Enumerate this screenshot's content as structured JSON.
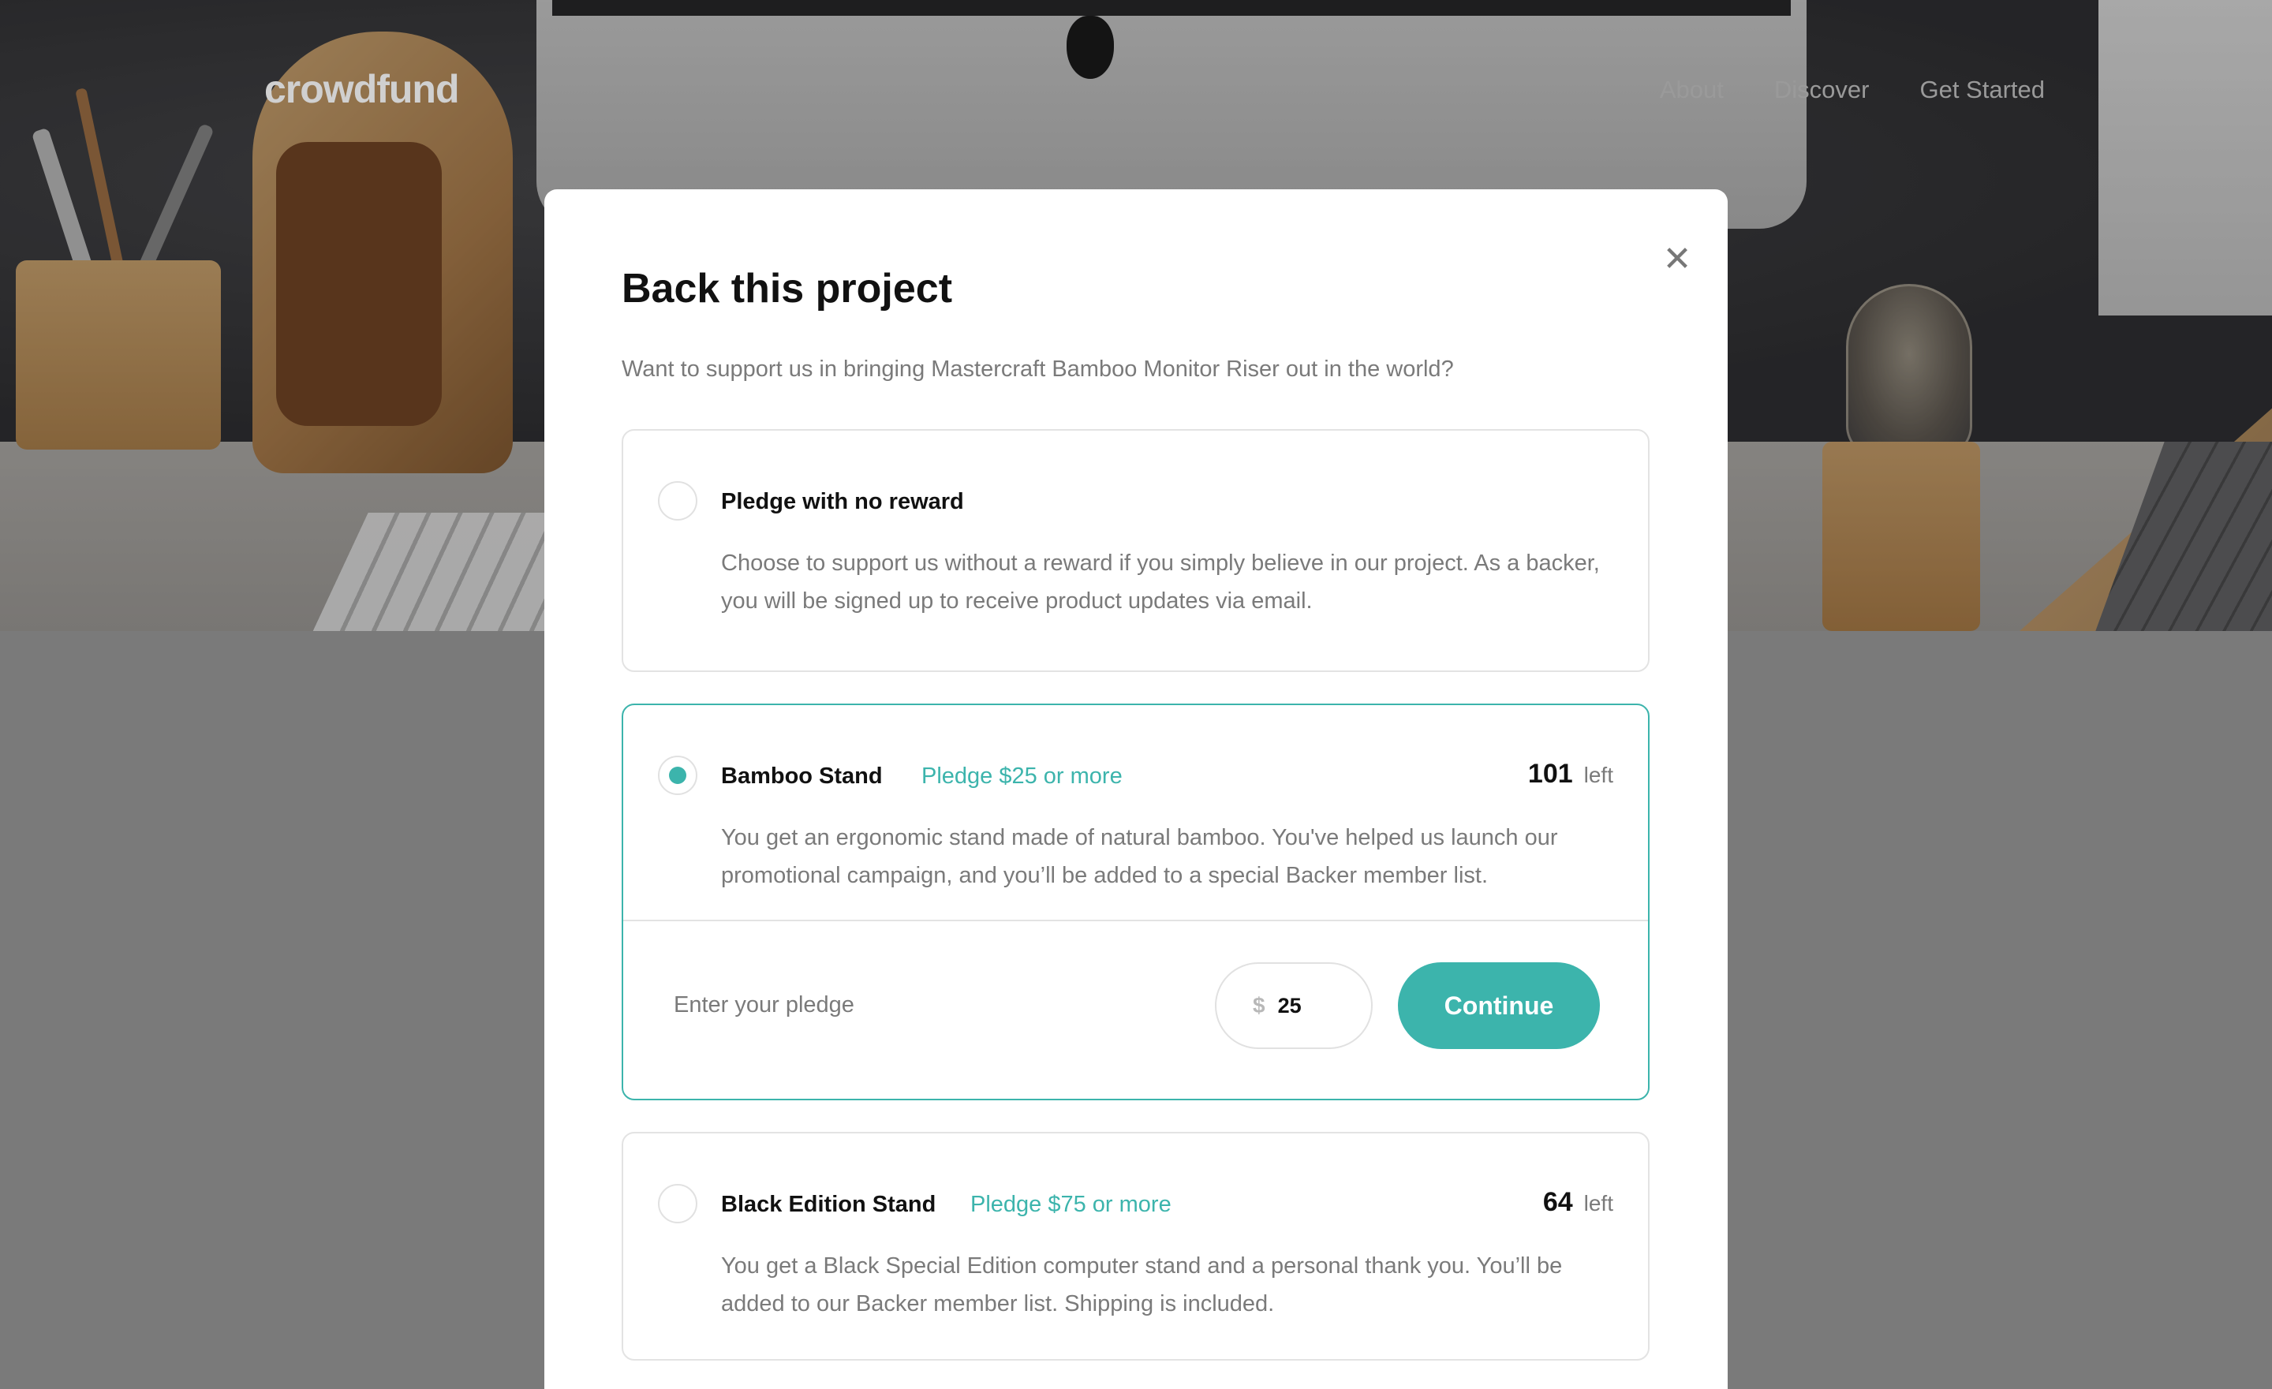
{
  "header": {
    "logo": "crowdfund",
    "nav": [
      {
        "label": "About"
      },
      {
        "label": "Discover"
      },
      {
        "label": "Get Started"
      }
    ]
  },
  "modal": {
    "title": "Back this project",
    "description": "Want to support us in bringing Mastercraft Bamboo Monitor Riser out in the world?",
    "close_icon": "close-icon",
    "rewards": [
      {
        "title": "Pledge with no reward",
        "description": "Choose to support us without a reward if you simply believe in our project. As a backer, you will be signed up to receive product updates via email.",
        "selected": false
      },
      {
        "title": "Bamboo Stand",
        "pledge_min": "Pledge $25 or more",
        "stock_count": "101",
        "stock_label": "left",
        "description": "You get an ergonomic stand made of natural bamboo. You've helped us launch our promotional campaign, and you’ll be added to a special Backer member list.",
        "selected": true,
        "pledge_form": {
          "label": "Enter your pledge",
          "currency": "$",
          "amount": "25",
          "button": "Continue"
        }
      },
      {
        "title": "Black Edition Stand",
        "pledge_min": "Pledge $75 or more",
        "stock_count": "64",
        "stock_label": "left",
        "description": "You get a Black Special Edition computer stand and a personal thank you. You’ll be added to our Backer member list. Shipping is included.",
        "selected": false
      }
    ]
  },
  "colors": {
    "accent": "#3cb4ac",
    "text_dark": "#111111",
    "text_muted": "#7a7a7a",
    "border": "#e3e3e3",
    "page_bg": "#7a7a7a"
  }
}
